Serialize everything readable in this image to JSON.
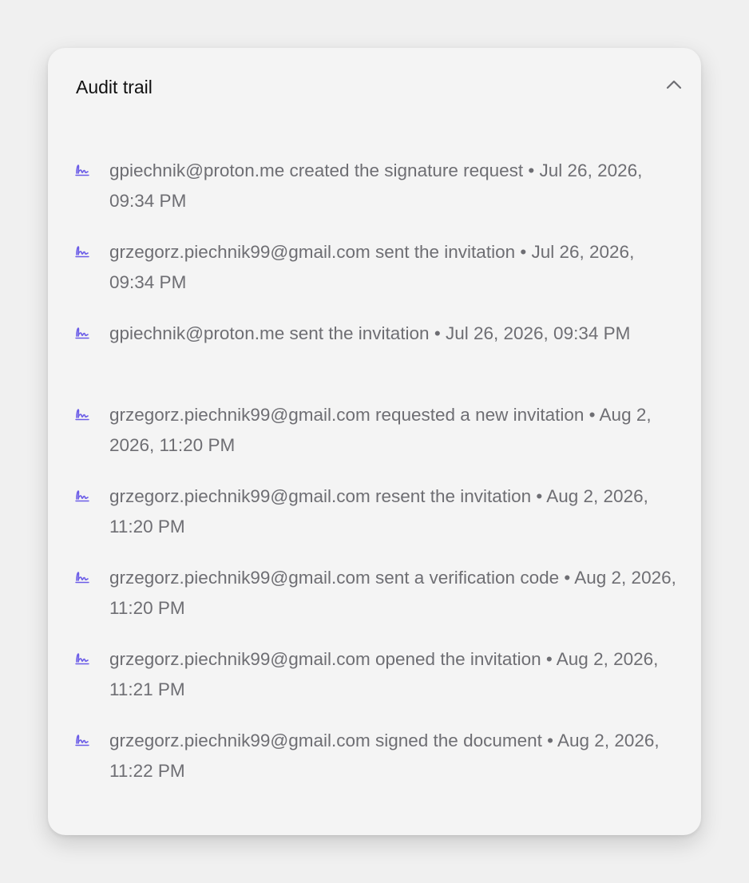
{
  "audit_trail": {
    "title": "Audit trail",
    "collapse_icon": "chevron-up-icon",
    "entry_icon": "signature-icon",
    "accent_color": "#6b5ce7",
    "entries": [
      {
        "text": "gpiechnik@proton.me created the signature request • Jul 26, 2026, 09:34 PM"
      },
      {
        "text": "grzegorz.piechnik99@gmail.com sent the invitation • Jul 26, 2026, 09:34 PM"
      },
      {
        "text": "gpiechnik@proton.me sent the invitation • Jul 26, 2026, 09:34 PM"
      },
      {
        "text": "grzegorz.piechnik99@gmail.com requested a new invitation • Aug 2, 2026, 11:20 PM"
      },
      {
        "text": "grzegorz.piechnik99@gmail.com resent the invitation • Aug 2, 2026, 11:20 PM"
      },
      {
        "text": "grzegorz.piechnik99@gmail.com sent a verification code • Aug 2, 2026, 11:20 PM"
      },
      {
        "text": "grzegorz.piechnik99@gmail.com opened the invitation • Aug 2, 2026, 11:21 PM"
      },
      {
        "text": "grzegorz.piechnik99@gmail.com signed the document • Aug 2, 2026, 11:22 PM"
      }
    ]
  }
}
